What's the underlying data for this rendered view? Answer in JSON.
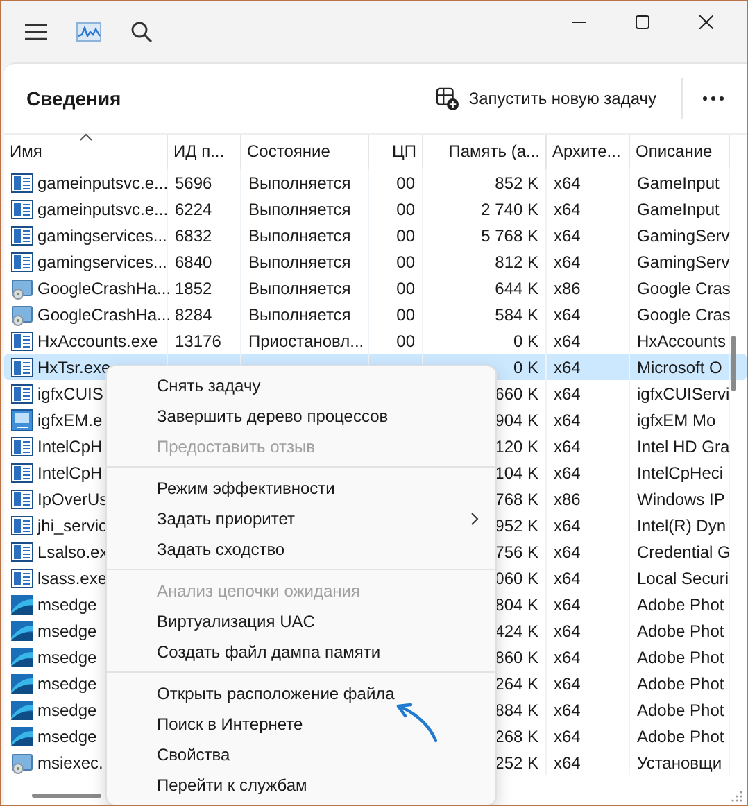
{
  "toolbar": {
    "title": "Сведения",
    "run_task_button": "Запустить новую задачу"
  },
  "table": {
    "columns": [
      {
        "label": "Имя",
        "sorted": true
      },
      {
        "label": "ИД п...",
        "sorted": false
      },
      {
        "label": "Состояние",
        "sorted": false
      },
      {
        "label": "ЦП",
        "sorted": false
      },
      {
        "label": "Память (а...",
        "sorted": false
      },
      {
        "label": "Архите...",
        "sorted": false
      },
      {
        "label": "Описание",
        "sorted": false
      }
    ],
    "rows": [
      {
        "kind": "app",
        "name": "gameinputsvc.e...",
        "pid": "5696",
        "status": "Выполняется",
        "cpu": "00",
        "memory": "852 K",
        "arch": "x64",
        "description": "GameInput",
        "selected": false
      },
      {
        "kind": "app",
        "name": "gameinputsvc.e...",
        "pid": "6224",
        "status": "Выполняется",
        "cpu": "00",
        "memory": "2 740 K",
        "arch": "x64",
        "description": "GameInput",
        "selected": false
      },
      {
        "kind": "app",
        "name": "gamingservices...",
        "pid": "6832",
        "status": "Выполняется",
        "cpu": "00",
        "memory": "5 768 K",
        "arch": "x64",
        "description": "GamingServ",
        "selected": false
      },
      {
        "kind": "app",
        "name": "gamingservices...",
        "pid": "6840",
        "status": "Выполняется",
        "cpu": "00",
        "memory": "812 K",
        "arch": "x64",
        "description": "GamingServ",
        "selected": false
      },
      {
        "kind": "installer",
        "name": "GoogleCrashHa...",
        "pid": "1852",
        "status": "Выполняется",
        "cpu": "00",
        "memory": "644 K",
        "arch": "x86",
        "description": "Google Cras",
        "selected": false
      },
      {
        "kind": "installer",
        "name": "GoogleCrashHa...",
        "pid": "8284",
        "status": "Выполняется",
        "cpu": "00",
        "memory": "584 K",
        "arch": "x64",
        "description": "Google Cras",
        "selected": false
      },
      {
        "kind": "app",
        "name": "HxAccounts.exe",
        "pid": "13176",
        "status": "Приостановл...",
        "cpu": "00",
        "memory": "0 K",
        "arch": "x64",
        "description": "HxAccounts",
        "selected": false
      },
      {
        "kind": "app",
        "name": "HxTsr.exe",
        "memory": "0 K",
        "arch": "x64",
        "description": "Microsoft O",
        "selected": true
      },
      {
        "kind": "app",
        "name": "igfxCUIS",
        "memory": "660 K",
        "arch": "x64",
        "description": "igfxCUIServi",
        "selected": false
      },
      {
        "kind": "display",
        "name": "igfxEM.e",
        "memory": "904 K",
        "arch": "x64",
        "description": "igfxEM Mo",
        "selected": false
      },
      {
        "kind": "app",
        "name": "IntelCpH",
        "memory": "120 K",
        "arch": "x64",
        "description": "Intel HD Gra",
        "selected": false
      },
      {
        "kind": "app",
        "name": "IntelCpH",
        "memory": "104 K",
        "arch": "x64",
        "description": "IntelCpHeci",
        "selected": false
      },
      {
        "kind": "app",
        "name": "IpOverUs",
        "memory": "768 K",
        "arch": "x86",
        "description": "Windows IP",
        "selected": false
      },
      {
        "kind": "app",
        "name": "jhi_servic",
        "memory": "952 K",
        "arch": "x64",
        "description": "Intel(R) Dyn",
        "selected": false
      },
      {
        "kind": "app",
        "name": "Lsalso.ex",
        "memory": "756 K",
        "arch": "x64",
        "description": "Credential G",
        "selected": false
      },
      {
        "kind": "app",
        "name": "lsass.exe",
        "memory": "060 K",
        "arch": "x64",
        "description": "Local Securi",
        "selected": false
      },
      {
        "kind": "edge",
        "name": "msedge",
        "memory": "804 K",
        "arch": "x64",
        "description": "Adobe Phot",
        "selected": false
      },
      {
        "kind": "edge",
        "name": "msedge",
        "memory": "424 K",
        "arch": "x64",
        "description": "Adobe Phot",
        "selected": false
      },
      {
        "kind": "edge",
        "name": "msedge",
        "memory": "860 K",
        "arch": "x64",
        "description": "Adobe Phot",
        "selected": false
      },
      {
        "kind": "edge",
        "name": "msedge",
        "memory": "264 K",
        "arch": "x64",
        "description": "Adobe Phot",
        "selected": false
      },
      {
        "kind": "edge",
        "name": "msedge",
        "memory": "884 K",
        "arch": "x64",
        "description": "Adobe Phot",
        "selected": false
      },
      {
        "kind": "edge",
        "name": "msedge",
        "memory": "268 K",
        "arch": "x64",
        "description": "Adobe Phot",
        "selected": false
      },
      {
        "kind": "installer",
        "name": "msiexec.",
        "memory": "252 K",
        "arch": "x64",
        "description": "Установщи",
        "selected": false
      }
    ]
  },
  "context_menu": {
    "items": [
      {
        "kind": "item",
        "label": "Снять задачу",
        "disabled": false,
        "submenu": false
      },
      {
        "kind": "item",
        "label": "Завершить дерево процессов",
        "disabled": false,
        "submenu": false
      },
      {
        "kind": "item",
        "label": "Предоставить отзыв",
        "disabled": true,
        "submenu": false
      },
      {
        "kind": "separator"
      },
      {
        "kind": "item",
        "label": "Режим эффективности",
        "disabled": false,
        "submenu": false
      },
      {
        "kind": "item",
        "label": "Задать приоритет",
        "disabled": false,
        "submenu": true
      },
      {
        "kind": "item",
        "label": "Задать сходство",
        "disabled": false,
        "submenu": false
      },
      {
        "kind": "separator"
      },
      {
        "kind": "item",
        "label": "Анализ цепочки ожидания",
        "disabled": true,
        "submenu": false
      },
      {
        "kind": "item",
        "label": "Виртуализация UAC",
        "disabled": false,
        "submenu": false
      },
      {
        "kind": "item",
        "label": "Создать файл дампа памяти",
        "disabled": false,
        "submenu": false
      },
      {
        "kind": "separator"
      },
      {
        "kind": "item",
        "label": "Открыть расположение файла",
        "disabled": false,
        "submenu": false
      },
      {
        "kind": "item",
        "label": "Поиск в Интернете",
        "disabled": false,
        "submenu": false
      },
      {
        "kind": "item",
        "label": "Свойства",
        "disabled": false,
        "submenu": false
      },
      {
        "kind": "item",
        "label": "Перейти к службам",
        "disabled": false,
        "submenu": false
      }
    ]
  }
}
